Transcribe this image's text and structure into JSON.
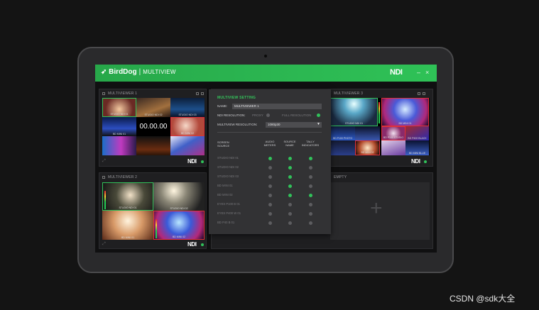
{
  "app": {
    "brand": "BirdDog",
    "title": "MULTIVIEW",
    "ndi_logo": "NDI",
    "minimize": "–",
    "close": "×"
  },
  "panels": [
    {
      "title": "MULTIVIEWER 1",
      "tiles": [
        {
          "label": "STUDIO NDI 01",
          "border": "green"
        },
        {
          "label": "STUDIO NDI 02",
          "border": "none"
        },
        {
          "label": "STUDIO NDI 03",
          "border": "none"
        },
        {
          "label": "BD MINI 01",
          "border": "none"
        },
        {
          "label": "",
          "border": "none"
        },
        {
          "label": "BD MINI 02",
          "border": "red"
        },
        {
          "label": "",
          "border": "none"
        },
        {
          "label": "",
          "border": "none"
        },
        {
          "label": "",
          "border": "none"
        }
      ],
      "clock": "00.00.00",
      "ndi": "NDI"
    },
    {
      "title": "MULTIVIEWER 2",
      "tiles": [
        {
          "label": "STUDIO NDI 01",
          "border": "green"
        },
        {
          "label": "STUDIO NDI 02",
          "border": "none"
        },
        {
          "label": "BD MINI 01",
          "border": "none"
        },
        {
          "label": "BD MINI 02",
          "border": "red"
        }
      ],
      "ndi": "NDI"
    },
    {
      "title": "MULTIVIEWER 3",
      "tiles": [
        {
          "label": "STUDIO NDI 01",
          "border": "green"
        },
        {
          "label": "BD MINI 01",
          "border": "red"
        },
        {
          "label": "BD P100 PHOTO",
          "border": "none"
        },
        {
          "label": "BD P400 BLACK",
          "border": "none"
        },
        {
          "label": "BD P100 STUDIO",
          "border": "red"
        },
        {
          "label": "BD MINI BLUE",
          "border": "none"
        },
        {
          "label": "BD MINI 02",
          "border": "none"
        }
      ],
      "ndi": "NDI"
    },
    {
      "title": "EMPTY",
      "add_symbol": "+"
    }
  ],
  "settings": {
    "title": "MULTIVIEW SETTING",
    "name_label": "NAME:",
    "name_value": "MULTIVIEWER 1",
    "ndi_res_label": "NDI RESOLUTION:",
    "proxy_label": "PROXY",
    "full_label": "FULL RESOLUTION",
    "mv_res_label": "MULTIVIEW RESOLUTION:",
    "mv_res_value": "1080p30",
    "headers": {
      "source": [
        "SCREEN",
        "SOURCE"
      ],
      "audio": [
        "AUDIO",
        "METERS"
      ],
      "name": [
        "SOURCE",
        "NAME"
      ],
      "tally": [
        "TALLY",
        "INDICATORS"
      ]
    },
    "rows": [
      {
        "label": "STUDIO NDI 01",
        "audio": true,
        "name": true,
        "tally": true
      },
      {
        "label": "STUDIO NDI 02",
        "audio": false,
        "name": true,
        "tally": false
      },
      {
        "label": "STUDIO NDI 03",
        "audio": false,
        "name": true,
        "tally": false
      },
      {
        "label": "BD MINI 01",
        "audio": false,
        "name": true,
        "tally": false
      },
      {
        "label": "BD MINI 02",
        "audio": false,
        "name": true,
        "tally": true
      },
      {
        "label": "EYES P100 B 01",
        "audio": false,
        "name": false,
        "tally": false
      },
      {
        "label": "EYES P400 W 01",
        "audio": false,
        "name": false,
        "tally": false
      },
      {
        "label": "BD P40 B 01",
        "audio": false,
        "name": false,
        "tally": false
      }
    ]
  },
  "colors": {
    "brand_green": "#2fc257",
    "tally_red": "#e0303a",
    "tally_green": "#31c25a"
  },
  "watermark": "CSDN @sdk大全"
}
